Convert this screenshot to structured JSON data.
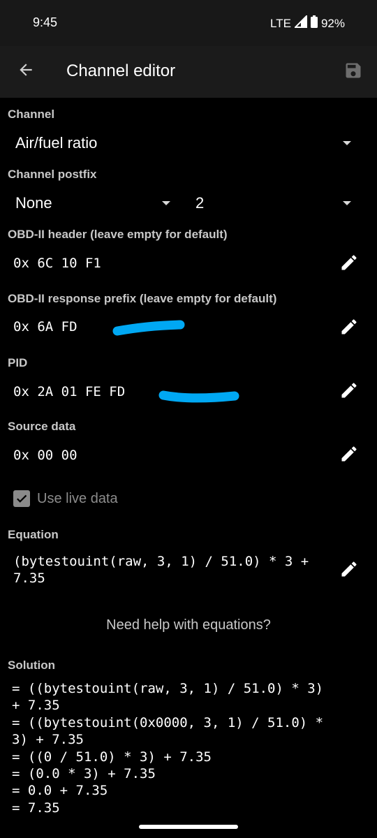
{
  "status_bar": {
    "time": "9:45",
    "network": "LTE",
    "battery": "92%"
  },
  "app_bar": {
    "title": "Channel editor",
    "back_icon": "arrow-back-icon",
    "save_icon": "save-icon"
  },
  "channel": {
    "label": "Channel",
    "value": "Air/fuel ratio"
  },
  "channel_postfix": {
    "label": "Channel postfix",
    "value": "None",
    "number_value": "2"
  },
  "obd_header": {
    "label": "OBD-II header (leave empty for default)",
    "value": "0x 6C 10 F1"
  },
  "obd_response_prefix": {
    "label": "OBD-II response prefix (leave empty for default)",
    "value": "0x 6A FD"
  },
  "pid": {
    "label": "PID",
    "value": "0x 2A 01 FE FD"
  },
  "source_data": {
    "label": "Source data",
    "value": "0x 00 00"
  },
  "live_data": {
    "label": "Use live data",
    "checked": true
  },
  "equation": {
    "label": "Equation",
    "value": "(bytestouint(raw, 3, 1) / 51.0) * 3 + 7.35"
  },
  "help_link": "Need help with equations?",
  "solution": {
    "label": "Solution",
    "lines": [
      "= ((bytestouint(raw, 3, 1) / 51.0) * 3)",
      "+ 7.35",
      "= ((bytestouint(0x0000, 3, 1) / 51.0) *",
      "3) + 7.35",
      "= ((0 / 51.0) * 3) + 7.35",
      "= (0.0 * 3) + 7.35",
      "= 0.0 + 7.35",
      "= 7.35"
    ]
  },
  "colors": {
    "background": "#000000",
    "app_bar": "#1b1b1b",
    "label_gray": "#c8c8c8",
    "scribble_blue": "#00a8f3"
  }
}
